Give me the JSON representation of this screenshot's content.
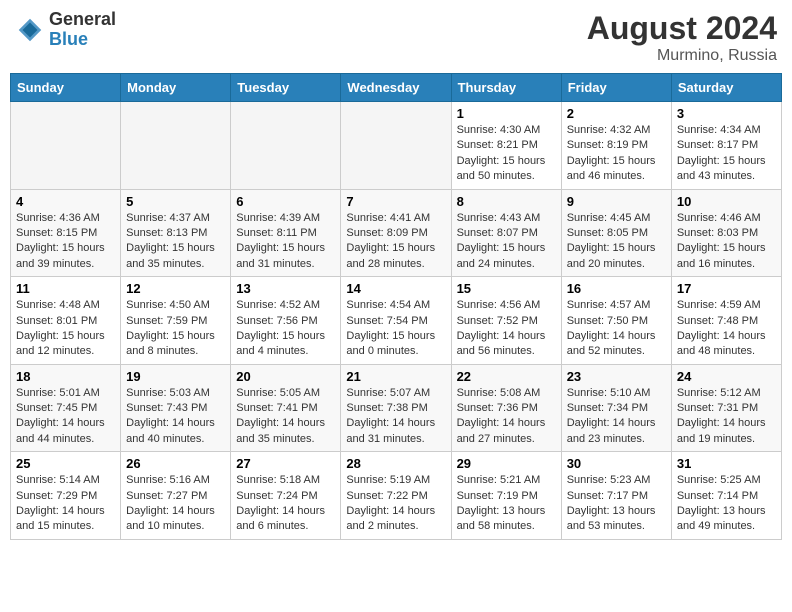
{
  "header": {
    "logo": {
      "general": "General",
      "blue": "Blue"
    },
    "month_year": "August 2024",
    "location": "Murmino, Russia"
  },
  "days_of_week": [
    "Sunday",
    "Monday",
    "Tuesday",
    "Wednesday",
    "Thursday",
    "Friday",
    "Saturday"
  ],
  "weeks": [
    {
      "days": [
        {
          "num": "",
          "empty": true
        },
        {
          "num": "",
          "empty": true
        },
        {
          "num": "",
          "empty": true
        },
        {
          "num": "",
          "empty": true
        },
        {
          "num": "1",
          "rise": "4:30 AM",
          "set": "8:21 PM",
          "daylight": "15 hours and 50 minutes."
        },
        {
          "num": "2",
          "rise": "4:32 AM",
          "set": "8:19 PM",
          "daylight": "15 hours and 46 minutes."
        },
        {
          "num": "3",
          "rise": "4:34 AM",
          "set": "8:17 PM",
          "daylight": "15 hours and 43 minutes."
        }
      ]
    },
    {
      "days": [
        {
          "num": "4",
          "rise": "4:36 AM",
          "set": "8:15 PM",
          "daylight": "15 hours and 39 minutes."
        },
        {
          "num": "5",
          "rise": "4:37 AM",
          "set": "8:13 PM",
          "daylight": "15 hours and 35 minutes."
        },
        {
          "num": "6",
          "rise": "4:39 AM",
          "set": "8:11 PM",
          "daylight": "15 hours and 31 minutes."
        },
        {
          "num": "7",
          "rise": "4:41 AM",
          "set": "8:09 PM",
          "daylight": "15 hours and 28 minutes."
        },
        {
          "num": "8",
          "rise": "4:43 AM",
          "set": "8:07 PM",
          "daylight": "15 hours and 24 minutes."
        },
        {
          "num": "9",
          "rise": "4:45 AM",
          "set": "8:05 PM",
          "daylight": "15 hours and 20 minutes."
        },
        {
          "num": "10",
          "rise": "4:46 AM",
          "set": "8:03 PM",
          "daylight": "15 hours and 16 minutes."
        }
      ]
    },
    {
      "days": [
        {
          "num": "11",
          "rise": "4:48 AM",
          "set": "8:01 PM",
          "daylight": "15 hours and 12 minutes."
        },
        {
          "num": "12",
          "rise": "4:50 AM",
          "set": "7:59 PM",
          "daylight": "15 hours and 8 minutes."
        },
        {
          "num": "13",
          "rise": "4:52 AM",
          "set": "7:56 PM",
          "daylight": "15 hours and 4 minutes."
        },
        {
          "num": "14",
          "rise": "4:54 AM",
          "set": "7:54 PM",
          "daylight": "15 hours and 0 minutes."
        },
        {
          "num": "15",
          "rise": "4:56 AM",
          "set": "7:52 PM",
          "daylight": "14 hours and 56 minutes."
        },
        {
          "num": "16",
          "rise": "4:57 AM",
          "set": "7:50 PM",
          "daylight": "14 hours and 52 minutes."
        },
        {
          "num": "17",
          "rise": "4:59 AM",
          "set": "7:48 PM",
          "daylight": "14 hours and 48 minutes."
        }
      ]
    },
    {
      "days": [
        {
          "num": "18",
          "rise": "5:01 AM",
          "set": "7:45 PM",
          "daylight": "14 hours and 44 minutes."
        },
        {
          "num": "19",
          "rise": "5:03 AM",
          "set": "7:43 PM",
          "daylight": "14 hours and 40 minutes."
        },
        {
          "num": "20",
          "rise": "5:05 AM",
          "set": "7:41 PM",
          "daylight": "14 hours and 35 minutes."
        },
        {
          "num": "21",
          "rise": "5:07 AM",
          "set": "7:38 PM",
          "daylight": "14 hours and 31 minutes."
        },
        {
          "num": "22",
          "rise": "5:08 AM",
          "set": "7:36 PM",
          "daylight": "14 hours and 27 minutes."
        },
        {
          "num": "23",
          "rise": "5:10 AM",
          "set": "7:34 PM",
          "daylight": "14 hours and 23 minutes."
        },
        {
          "num": "24",
          "rise": "5:12 AM",
          "set": "7:31 PM",
          "daylight": "14 hours and 19 minutes."
        }
      ]
    },
    {
      "days": [
        {
          "num": "25",
          "rise": "5:14 AM",
          "set": "7:29 PM",
          "daylight": "14 hours and 15 minutes."
        },
        {
          "num": "26",
          "rise": "5:16 AM",
          "set": "7:27 PM",
          "daylight": "14 hours and 10 minutes."
        },
        {
          "num": "27",
          "rise": "5:18 AM",
          "set": "7:24 PM",
          "daylight": "14 hours and 6 minutes."
        },
        {
          "num": "28",
          "rise": "5:19 AM",
          "set": "7:22 PM",
          "daylight": "14 hours and 2 minutes."
        },
        {
          "num": "29",
          "rise": "5:21 AM",
          "set": "7:19 PM",
          "daylight": "13 hours and 58 minutes."
        },
        {
          "num": "30",
          "rise": "5:23 AM",
          "set": "7:17 PM",
          "daylight": "13 hours and 53 minutes."
        },
        {
          "num": "31",
          "rise": "5:25 AM",
          "set": "7:14 PM",
          "daylight": "13 hours and 49 minutes."
        }
      ]
    }
  ]
}
